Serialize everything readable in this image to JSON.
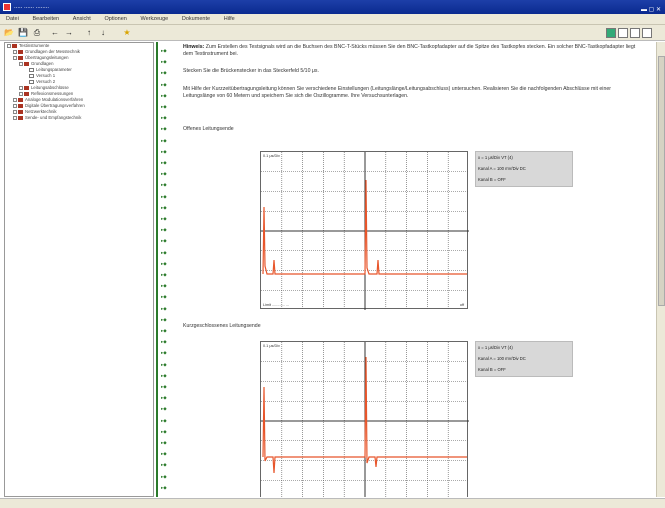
{
  "window": {
    "title": "..... ...... ........"
  },
  "menu": [
    "Datei",
    "Bearbeiten",
    "Ansicht",
    "Optionen",
    "Werkzeuge",
    "Dokumente",
    "Hilfe"
  ],
  "tree": [
    {
      "label": "Testinstrumente",
      "level": 0
    },
    {
      "label": "Grundlagen der Messtechnik",
      "level": 1
    },
    {
      "label": "Übertragungsleitungen",
      "level": 1
    },
    {
      "label": "Grundlagen",
      "level": 2
    },
    {
      "label": "Leitungsparameter",
      "level": 3
    },
    {
      "label": "Versuch 1",
      "level": 3
    },
    {
      "label": "Versuch 2",
      "level": 3
    },
    {
      "label": "Leitungsabschlüsse",
      "level": 2
    },
    {
      "label": "Reflexionsmessungen",
      "level": 2
    },
    {
      "label": "Analoge Modulationsverfahren",
      "level": 1
    },
    {
      "label": "Digitale Übertragungsverfahren",
      "level": 1
    },
    {
      "label": "Netzwerktechnik",
      "level": 1
    },
    {
      "label": "Sende- und Empfangstechnik",
      "level": 1
    }
  ],
  "content": {
    "hint_label": "Hinweis:",
    "hint_text": "Zum Erstellen des Testsignals wird an die Buchsen des BNC-T-Stücks müssen Sie den BNC-Tastkopfadapter auf die Spitze des Tastkopfes stecken. Ein solcher BNC-Tastkopfadapter liegt dem Testinstrument bei.",
    "step": "Stecken Sie die Brückenstecker in das Steckerfeld 5/10 μs.",
    "paragraph": "Mit Hilfe der Kurzzeitübertragungsleitung können Sie verschiedene Einstellungen (Leitungslänge/Leitungsabschluss) untersuchen. Realisieren Sie die nachfolgenden Abschlüsse mit einer Leitungslänge von 60 Metern und speichern Sie sich die Oszillogramme. Ihre Versuchsunterlagen.",
    "section1": "Offenes Leitungsende",
    "section2": "Kurzgeschlossenes Leitungsende"
  },
  "scope_panel": {
    "row1": "x =   1   μs/Div  VT (4)",
    "row2": "Kanal A =  100  mV/Div  DC",
    "row3": "Kanal B =           OFF"
  },
  "scope_labels": {
    "top_left": "0.1 μs/Div",
    "bottom_left": "Limit ............ ...",
    "bottom_right": "off"
  },
  "colors": {
    "trace": "#e8552a",
    "tree_book": "#a32",
    "margin_bar": "#2a7a2a"
  }
}
